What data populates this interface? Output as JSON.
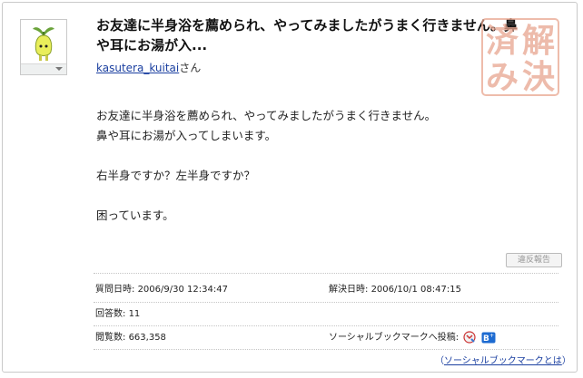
{
  "question": {
    "title": "お友達に半身浴を薦められ、やってみましたがうまく行きません。鼻や耳にお湯が入...",
    "asker_name": "kasutera_kuitai",
    "asker_suffix": "さん",
    "body_lines": [
      "お友達に半身浴を薦められ、やってみましたがうまく行きません。",
      "鼻や耳にお湯が入ってしまいます。",
      "",
      "右半身ですか？左半身ですか？",
      "",
      "困っています。"
    ],
    "stamp_text": "解決済み"
  },
  "actions": {
    "report_label": "違反報告"
  },
  "meta": {
    "asked_label": "質問日時:",
    "asked_value": "2006/9/30 12:34:47",
    "resolved_label": "解決日時:",
    "resolved_value": "2006/10/1 08:47:15",
    "answers_label": "回答数:",
    "answers_value": "11",
    "views_label": "閲覧数:",
    "views_value": "663,358",
    "social_label": "ソーシャルブックマークへ投稿:",
    "social_what_prefix": "（",
    "social_what_link": "ソーシャルブックマークとは",
    "social_what_suffix": "）"
  },
  "colors": {
    "link": "#1a3fa0",
    "stamp": "#e8a58f",
    "border": "#c9c9c9"
  },
  "icons": [
    "avatar-sprout-icon",
    "yahoo-bookmark-icon",
    "hatena-bookmark-icon"
  ]
}
